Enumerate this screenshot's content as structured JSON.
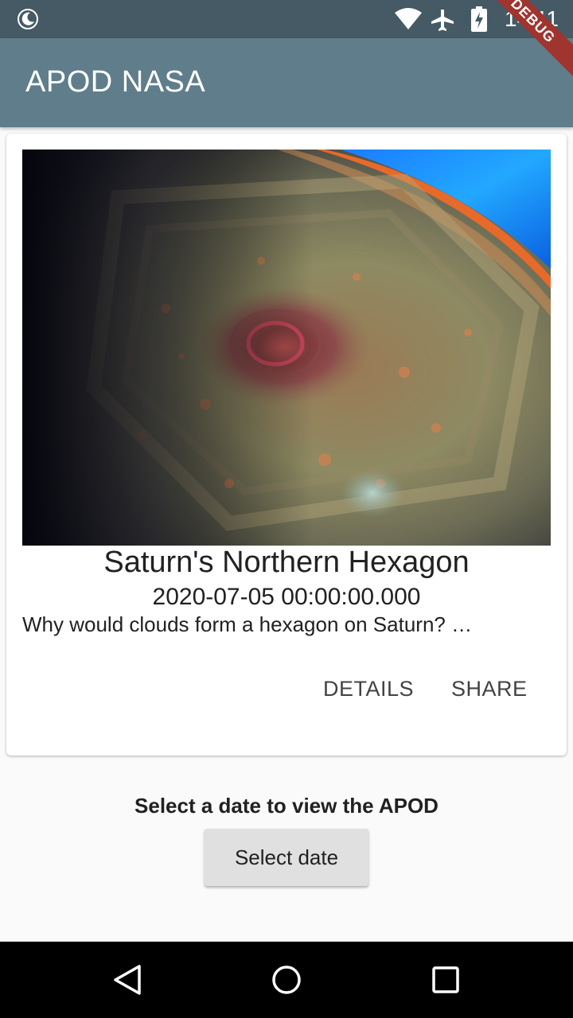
{
  "status_bar": {
    "time": "14:11",
    "icons": [
      "moon-icon",
      "wifi-icon",
      "airplane-icon",
      "battery-icon"
    ]
  },
  "app_bar": {
    "title": "APOD NASA"
  },
  "debug_banner": {
    "label": "DEBUG"
  },
  "card": {
    "image_name": "saturn-hexagon-image",
    "title": "Saturn's Northern Hexagon",
    "date": "2020-07-05 00:00:00.000",
    "description": "Why would clouds form a hexagon on Saturn? …",
    "details_label": "DETAILS",
    "share_label": "SHARE"
  },
  "date_select": {
    "prompt": "Select a date to view the APOD",
    "button_label": "Select date"
  },
  "nav_bar": {
    "icons": [
      "back-icon",
      "home-icon",
      "recents-icon"
    ]
  },
  "colors": {
    "status_bar": "#455a64",
    "app_bar": "#607d8b",
    "debug_banner": "#a0342e",
    "background": "#fafafa",
    "button": "#e0e0e0"
  }
}
